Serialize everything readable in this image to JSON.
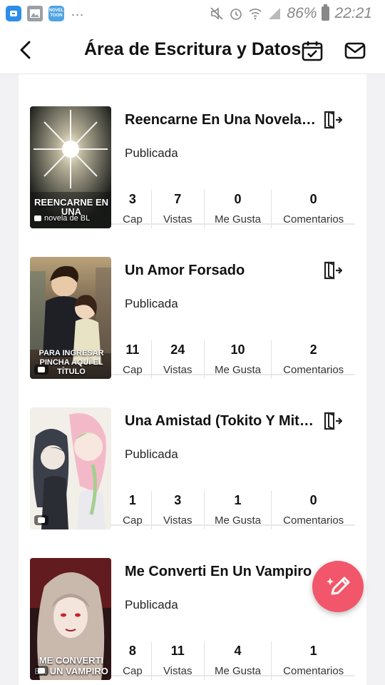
{
  "status_bar": {
    "battery": "86%",
    "time": "22:21",
    "dots": "...",
    "app_c": "NOVEL TOON"
  },
  "header": {
    "title": "Área de Escritura y Datos"
  },
  "stat_labels": {
    "chapters": "Cap",
    "views": "Vistas",
    "likes": "Me Gusta",
    "comments": "Comentarios"
  },
  "stories": [
    {
      "title": "Reencarne En Una Novela ...",
      "status": "Publicada",
      "chapters": "3",
      "views": "7",
      "likes": "0",
      "comments": "0",
      "cover_text": "REENCARNE EN UNA",
      "cover_sub": "novela de BL"
    },
    {
      "title": "Un Amor Forsado",
      "status": "Publicada",
      "chapters": "11",
      "views": "24",
      "likes": "10",
      "comments": "2",
      "cover_text": "PARA INGRESAR PINCHA AQUÍ EL TÍTULO",
      "cover_sub": ""
    },
    {
      "title": "Una Amistad (Tokito Y Mits...",
      "status": "Publicada",
      "chapters": "1",
      "views": "3",
      "likes": "1",
      "comments": "0",
      "cover_text": "",
      "cover_sub": ""
    },
    {
      "title": "Me Converti En Un Vampiro",
      "status": "Publicada",
      "chapters": "8",
      "views": "11",
      "likes": "4",
      "comments": "1",
      "cover_text": "ME CONVERTI EN UN VAMPIRO",
      "cover_sub": ""
    }
  ]
}
